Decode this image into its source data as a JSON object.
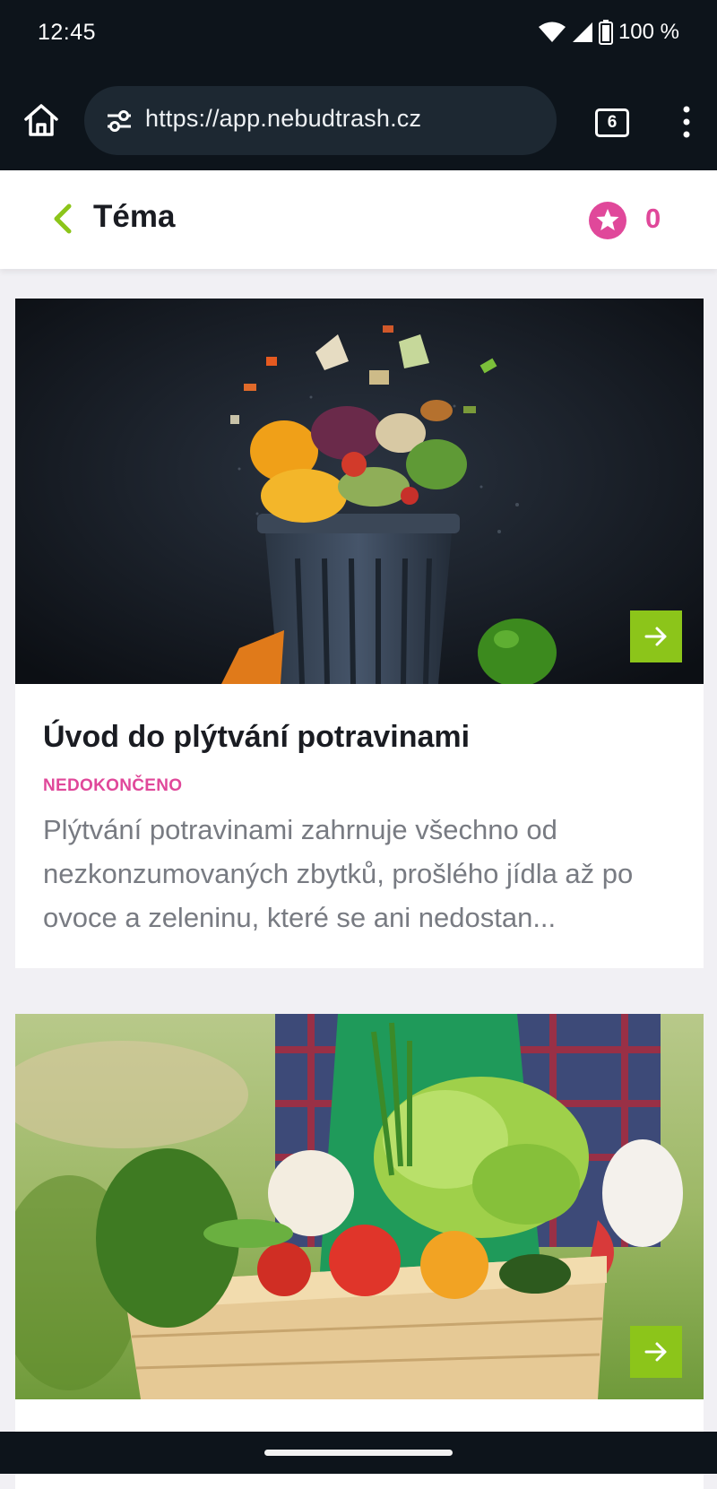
{
  "status_bar": {
    "time": "12:45",
    "battery": "100 %",
    "icons": [
      "wifi-icon",
      "signal-icon",
      "battery-icon"
    ]
  },
  "browser": {
    "url": "https://app.nebudtrash.cz",
    "tab_count": "6",
    "icons": [
      "home-icon",
      "site-settings-icon",
      "tabs-icon",
      "more-menu-icon"
    ]
  },
  "header": {
    "title": "Téma",
    "points": "0",
    "icons": [
      "back-chevron-icon",
      "star-icon"
    ]
  },
  "cards": [
    {
      "title": "Úvod do plýtvání potravinami",
      "status": "NEDOKONČENO",
      "description": "Plýtvání potravinami zahrnuje všechno od nezkonzumovaných zbytků, prošlého jídla až po ovoce a zeleninu, které se ani nedostan...",
      "image": "food waste flying into trash bin"
    },
    {
      "title": "",
      "status": "",
      "description": "",
      "image": "wooden crate of fresh vegetables"
    }
  ],
  "colors": {
    "accent_green": "#8cc51a",
    "accent_pink": "#e0489a",
    "system_bar": "#0d141b"
  }
}
